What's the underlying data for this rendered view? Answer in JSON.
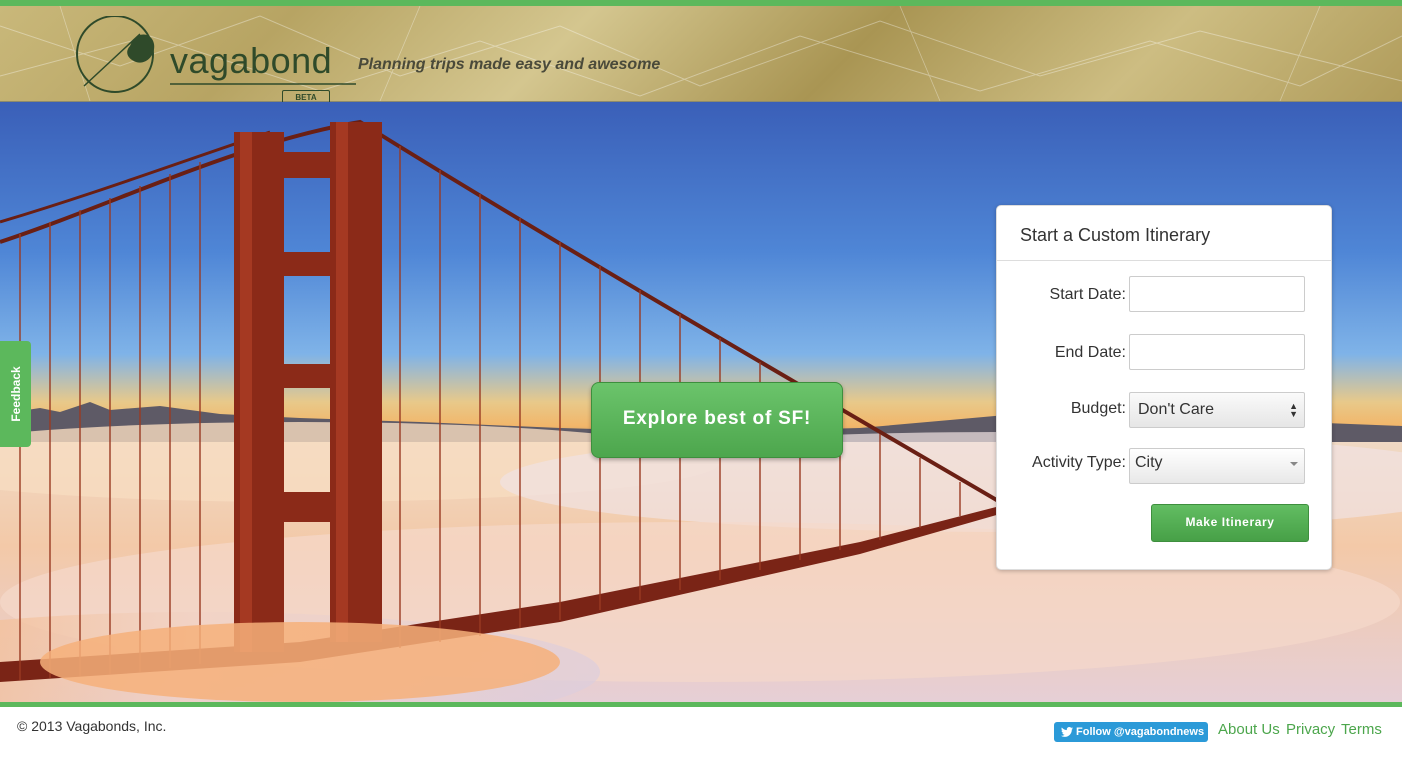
{
  "header": {
    "logo_text": "vagabond",
    "beta_label": "BETA",
    "tagline": "Planning trips made easy and awesome"
  },
  "hero": {
    "explore_button": "Explore best of SF!"
  },
  "feedback_tab": {
    "label": "Feedback"
  },
  "itinerary_panel": {
    "title": "Start a Custom Itinerary",
    "start_date": {
      "label": "Start Date:",
      "value": ""
    },
    "end_date": {
      "label": "End Date:",
      "value": ""
    },
    "budget": {
      "label": "Budget:",
      "selected": "Don't Care"
    },
    "activity_type": {
      "label": "Activity Type:",
      "selected": "City"
    },
    "submit_label": "Make Itinerary"
  },
  "footer": {
    "copyright": "© 2013 Vagabonds, Inc.",
    "twitter_follow": "Follow @vagabondnews",
    "links": [
      "About Us",
      "Privacy",
      "Terms"
    ]
  },
  "colors": {
    "accent_green": "#5cb85c",
    "link_green": "#4ca64c",
    "twitter_blue": "#2b9ad8",
    "logo_green": "#2f4a2a"
  }
}
